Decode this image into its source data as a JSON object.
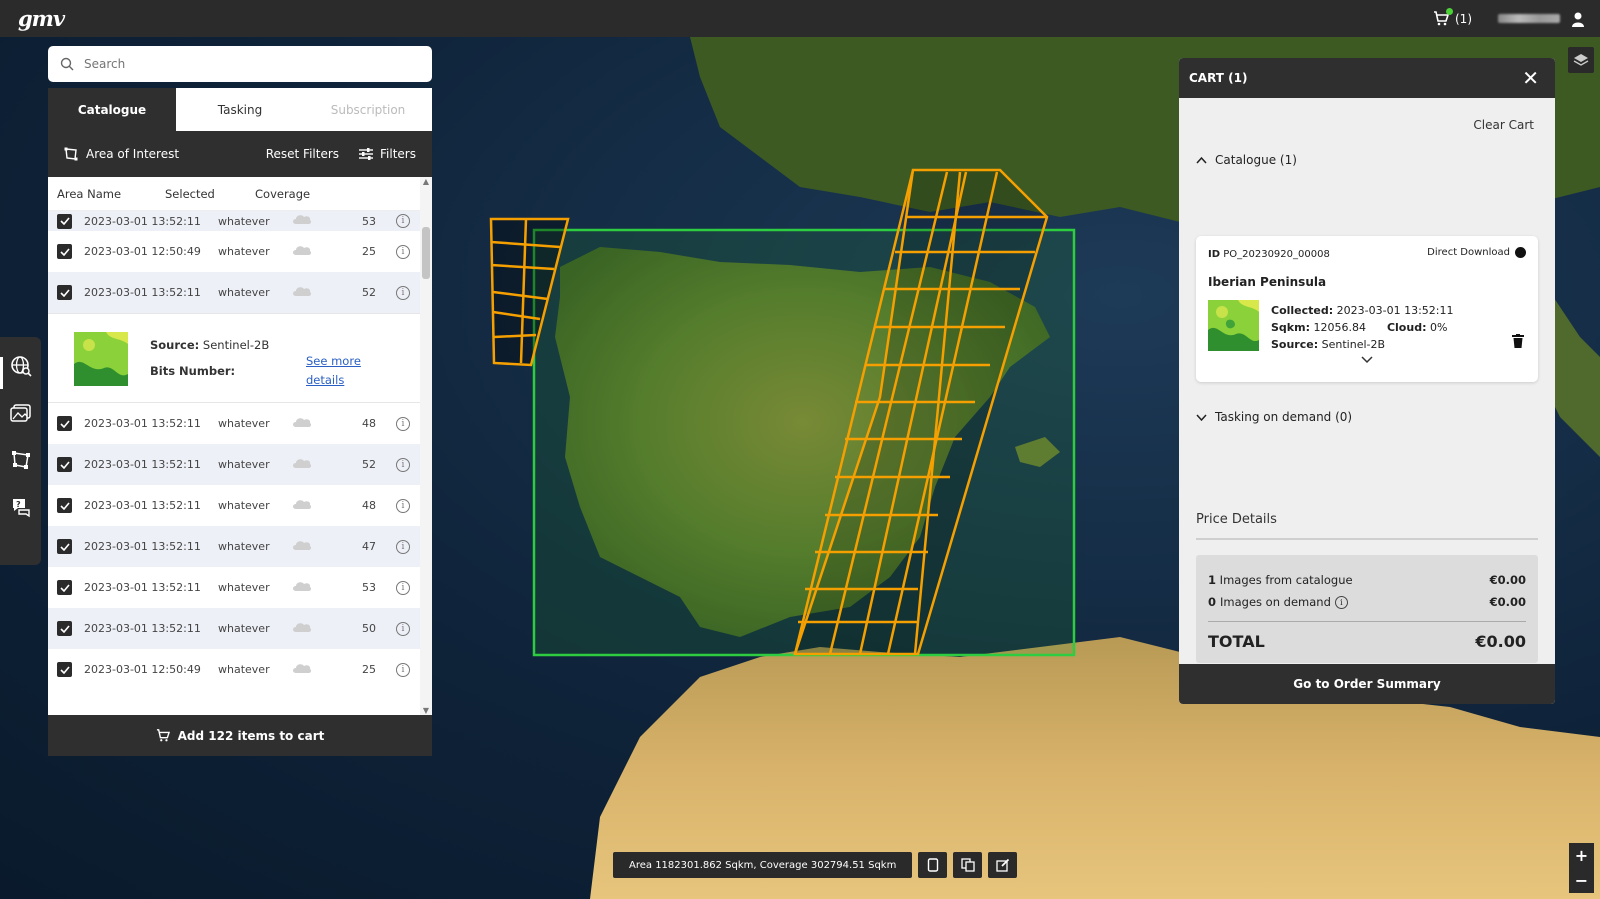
{
  "topbar": {
    "logo": "gmv",
    "cart_label": "(1)"
  },
  "search": {
    "placeholder": "Search"
  },
  "tabs": [
    {
      "label": "Catalogue",
      "state": "active"
    },
    {
      "label": "Tasking",
      "state": "inactive"
    },
    {
      "label": "Subscription",
      "state": "disabled"
    }
  ],
  "filterbar": {
    "aoi": "Area of Interest",
    "reset": "Reset Filters",
    "filters": "Filters"
  },
  "list": {
    "headers": [
      "Area Name",
      "Selected",
      "Coverage"
    ],
    "rows": [
      {
        "date": "2023-03-01 13:52:11",
        "selected": "whatever",
        "coverage": "53"
      },
      {
        "date": "2023-03-01 12:50:49",
        "selected": "whatever",
        "coverage": "25"
      },
      {
        "date": "2023-03-01 13:52:11",
        "selected": "whatever",
        "coverage": "52"
      },
      {
        "date": "2023-03-01 13:52:11",
        "selected": "whatever",
        "coverage": "48"
      },
      {
        "date": "2023-03-01 13:52:11",
        "selected": "whatever",
        "coverage": "52"
      },
      {
        "date": "2023-03-01 13:52:11",
        "selected": "whatever",
        "coverage": "48"
      },
      {
        "date": "2023-03-01 13:52:11",
        "selected": "whatever",
        "coverage": "47"
      },
      {
        "date": "2023-03-01 13:52:11",
        "selected": "whatever",
        "coverage": "53"
      },
      {
        "date": "2023-03-01 13:52:11",
        "selected": "whatever",
        "coverage": "50"
      },
      {
        "date": "2023-03-01 12:50:49",
        "selected": "whatever",
        "coverage": "25"
      }
    ],
    "detail": {
      "source_label": "Source:",
      "source_value": "Sentinel-2B",
      "bits_label": "Bits Number:",
      "link": "See more details"
    },
    "add_button": "Add 122 items to cart"
  },
  "cart": {
    "title": "CART (1)",
    "clear": "Clear Cart",
    "catalogue_section": "Catalogue (1)",
    "tasking_section": "Tasking on demand (0)",
    "item": {
      "id_label": "ID",
      "id": "PO_20230920_00008",
      "download": "Direct Download",
      "name": "Iberian Peninsula",
      "collected_label": "Collected:",
      "collected": "2023-03-01 13:52:11",
      "sqkm_label": "Sqkm:",
      "sqkm": "12056.84",
      "cloud_label": "Cloud:",
      "cloud": "0%",
      "source_label": "Source:",
      "source": "Sentinel-2B"
    },
    "price": {
      "title": "Price Details",
      "catalogue_count": "1",
      "catalogue_label": "Images from catalogue",
      "catalogue_value": "€0.00",
      "demand_count": "0",
      "demand_label": "Images on demand",
      "demand_value": "€0.00",
      "total_label": "TOTAL",
      "total_value": "€0.00"
    },
    "order_button": "Go to Order Summary"
  },
  "status": {
    "text": "Area 1182301.862 Sqkm, Coverage 302794.51 Sqkm"
  },
  "colors": {
    "panel": "#2f2f2f",
    "aoi": "#2ecc40",
    "footprint": "#f5a000",
    "link": "#2a5fc4"
  }
}
